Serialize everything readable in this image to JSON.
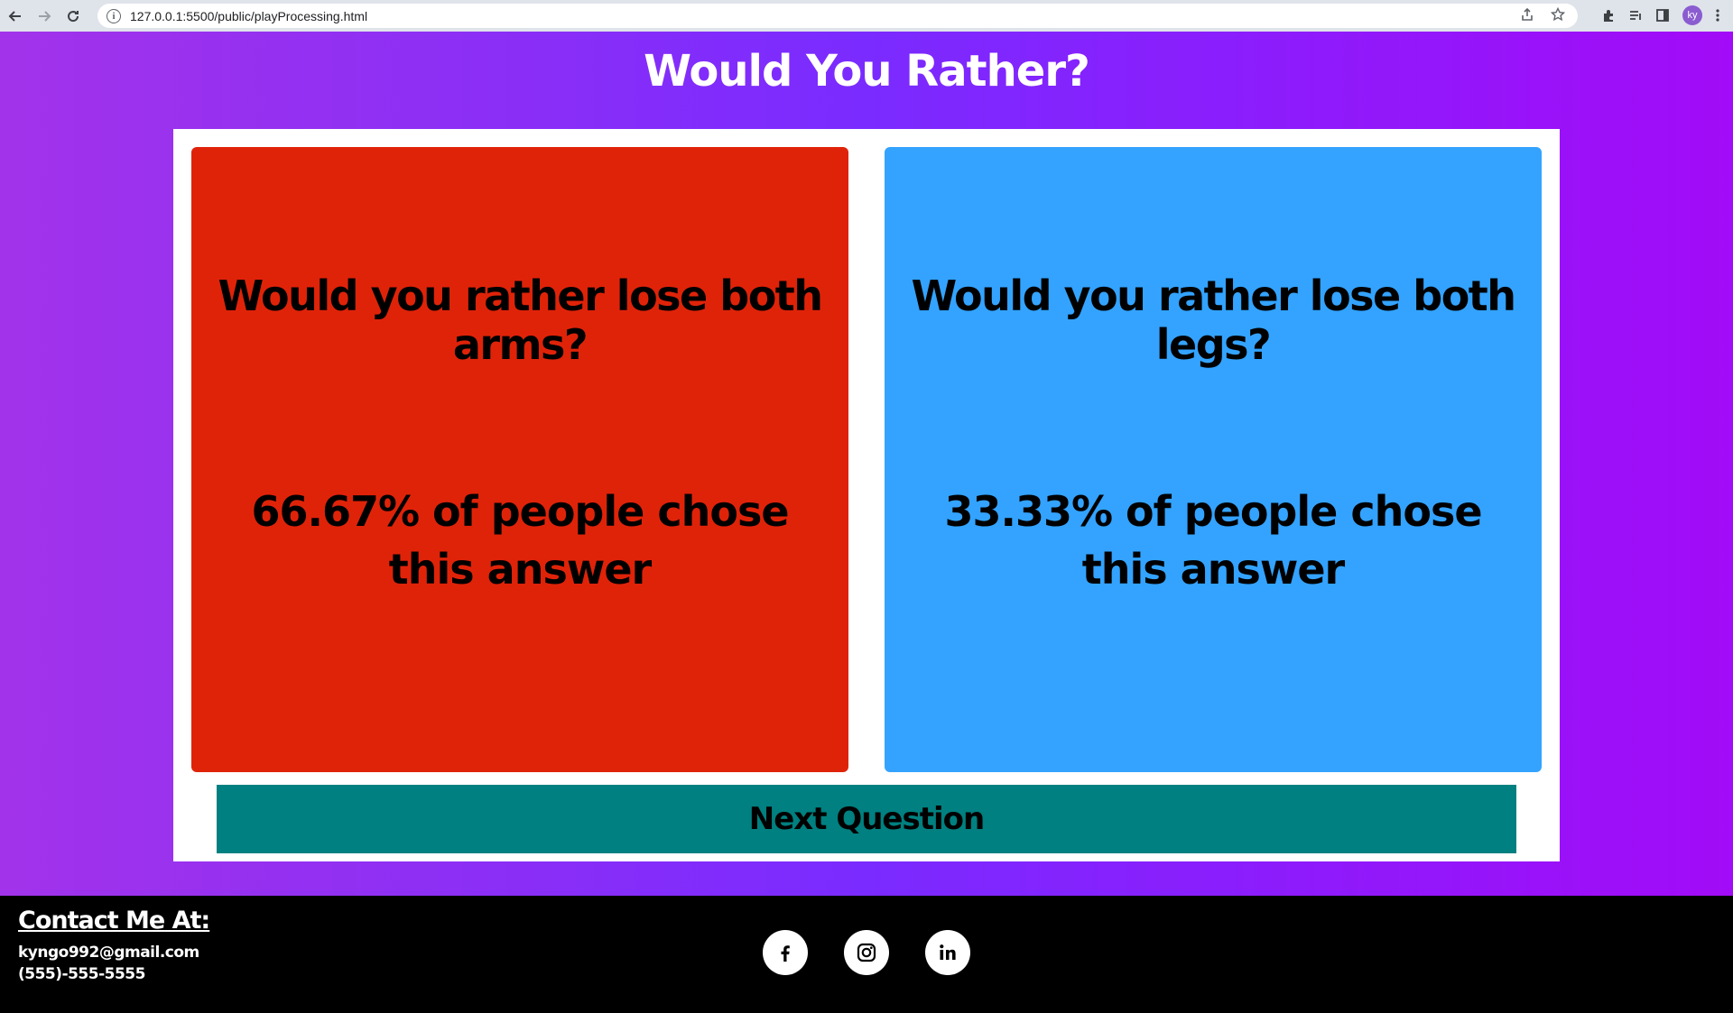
{
  "browser": {
    "url": "127.0.0.1:5500/public/playProcessing.html",
    "avatar_initials": "ky"
  },
  "page": {
    "title": "Would You Rather?",
    "option_a": {
      "question": "Would you rather lose both arms?",
      "result": "66.67% of people chose this answer",
      "percent": 66.67,
      "color": "#df2309"
    },
    "option_b": {
      "question": "Would you rather lose both legs?",
      "result": "33.33% of people chose this answer",
      "percent": 33.33,
      "color": "#33a3ff"
    },
    "next_button_label": "Next Question",
    "next_button_color": "#008080"
  },
  "footer": {
    "contact_title": "Contact Me At:",
    "email": "kyngo992@gmail.com",
    "phone": "(555)-555-5555",
    "social_icons": [
      "facebook-icon",
      "instagram-icon",
      "linkedin-icon"
    ]
  }
}
